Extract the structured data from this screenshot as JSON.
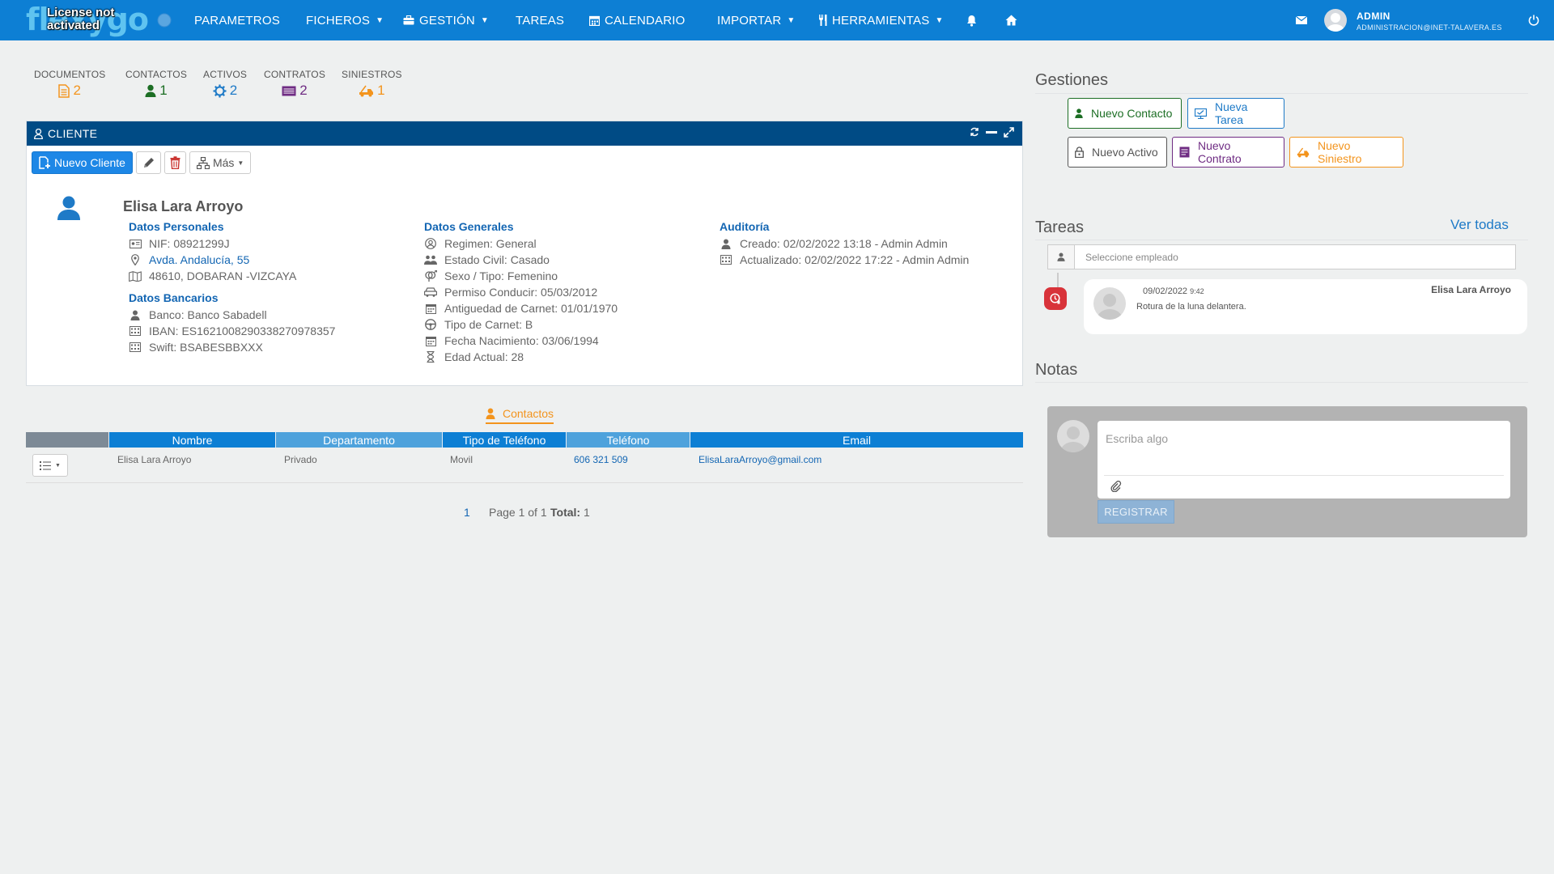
{
  "nav": {
    "logo_text": "flexygo",
    "license_warning": "License not activated",
    "items": [
      {
        "label": "PARAMETROS"
      },
      {
        "label": "FICHEROS"
      },
      {
        "label": "GESTIÓN"
      },
      {
        "label": "TAREAS"
      },
      {
        "label": "CALENDARIO"
      },
      {
        "label": "IMPORTAR"
      },
      {
        "label": "HERRAMIENTAS"
      }
    ],
    "user": {
      "name": "ADMIN",
      "email": "ADMINISTRACION@INET-TALAVERA.ES"
    }
  },
  "stats": [
    {
      "label": "DOCUMENTOS",
      "value": "2",
      "icon": "document-icon",
      "color": "#f3941d"
    },
    {
      "label": "CONTACTOS",
      "value": "1",
      "icon": "user-icon",
      "color": "#1c6e24"
    },
    {
      "label": "ACTIVOS",
      "value": "2",
      "icon": "gear-icon",
      "color": "#1e7ac7"
    },
    {
      "label": "CONTRATOS",
      "value": "2",
      "icon": "contract-icon",
      "color": "#6f2c83"
    },
    {
      "label": "SINIESTROS",
      "value": "1",
      "icon": "tow-truck-icon",
      "color": "#f3941d"
    }
  ],
  "client_panel": {
    "title": "CLIENTE",
    "new_button": "Nuevo Cliente",
    "more_button": "Más",
    "name": "Elisa Lara Arroyo",
    "personal": {
      "title": "Datos Personales",
      "nif": "NIF: 08921299J",
      "address": "Avda. Andalucía, 55",
      "city": "48610, DOBARAN -VIZCAYA"
    },
    "bank": {
      "title": "Datos Bancarios",
      "bank": "Banco: Banco Sabadell",
      "iban": "IBAN: ES1621008290338270978357",
      "swift": "Swift: BSABESBBXXX"
    },
    "general": {
      "title": "Datos Generales",
      "regimen": "Regimen: General",
      "civil": "Estado Civil: Casado",
      "sexo": "Sexo / Tipo: Femenino",
      "permiso": "Permiso Conducir: 05/03/2012",
      "antiguedad": "Antiguedad de Carnet: 01/01/1970",
      "tipo_carnet": "Tipo de Carnet: B",
      "nacimiento": "Fecha Nacimiento: 03/06/1994",
      "edad": "Edad Actual: 28"
    },
    "audit": {
      "title": "Auditoría",
      "created": "Creado: 02/02/2022 13:18 - Admin Admin",
      "updated": "Actualizado: 02/02/2022 17:22 - Admin Admin"
    }
  },
  "contacts": {
    "tab_label": "Contactos",
    "headers": [
      "Nombre",
      "Departamento",
      "Tipo de Teléfono",
      "Teléfono",
      "Email"
    ],
    "header_colors": {
      "dark": "#0d7fd4",
      "light": "#4ea2dc",
      "gray": "#7d8a96"
    },
    "rows": [
      {
        "nombre": "Elisa Lara Arroyo",
        "departamento": "Privado",
        "tipo": "Movil",
        "telefono": "606 321 509",
        "email": "ElisaLaraArroyo@gmail.com"
      }
    ],
    "pager": {
      "current": "1",
      "text": "Page 1 of 1",
      "total_label": "Total:",
      "total": "1"
    }
  },
  "gestiones": {
    "title": "Gestiones",
    "buttons": [
      {
        "label": "Nuevo Contacto",
        "color": "#1c6e24"
      },
      {
        "label": "Nueva Tarea",
        "color": "#1e7ac7"
      },
      {
        "label": "Nuevo Activo",
        "color": "#555555"
      },
      {
        "label": "Nuevo Contrato",
        "color": "#6f2c83"
      },
      {
        "label": "Nuevo Siniestro",
        "color": "#f3941d"
      }
    ]
  },
  "tareas": {
    "title": "Tareas",
    "see_all": "Ver todas",
    "employee_placeholder": "Seleccione empleado",
    "items": [
      {
        "date": "09/02/2022",
        "time": "9:42",
        "person": "Elisa Lara Arroyo",
        "text": "Rotura de la luna delantera."
      }
    ]
  },
  "notas": {
    "title": "Notas",
    "placeholder": "Escriba algo",
    "submit": "REGISTRAR"
  }
}
